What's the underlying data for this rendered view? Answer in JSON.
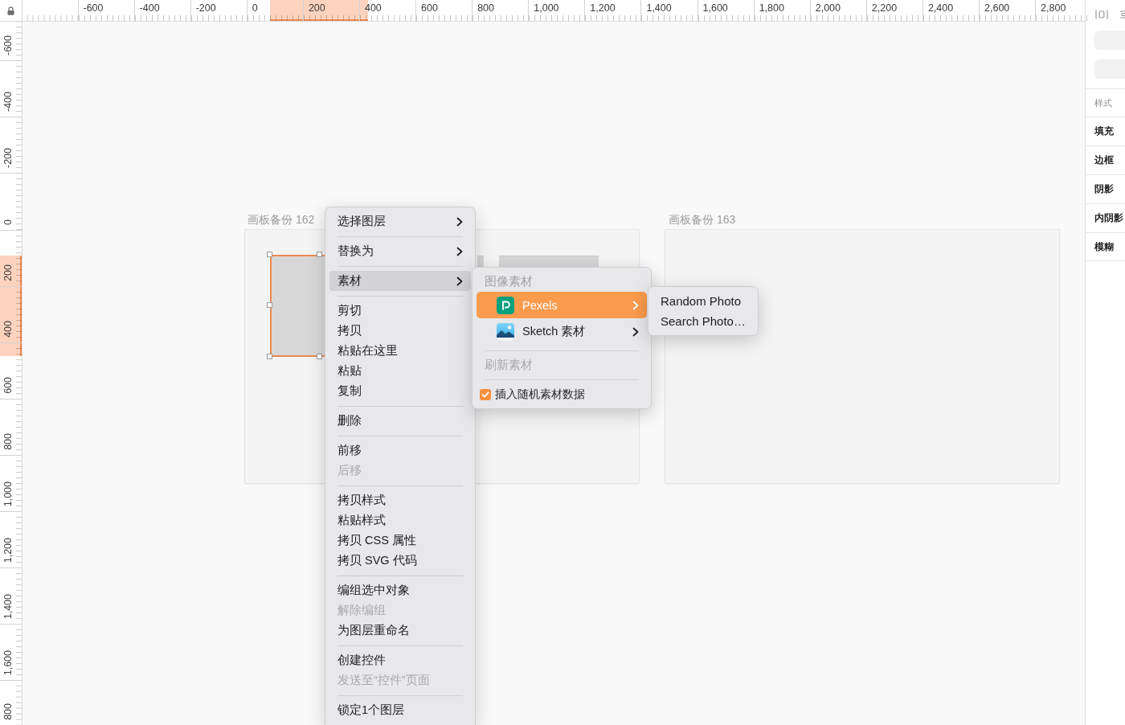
{
  "rulers": {
    "horizontal": [
      "-600",
      "-400",
      "-200",
      "0",
      "200",
      "400",
      "600",
      "800",
      "1,000",
      "1,200",
      "1,400",
      "1,600",
      "1,800",
      "2,000",
      "2,200",
      "2,400",
      "2,600",
      "2,800"
    ],
    "vertical": [
      "-600",
      "-400",
      "-200",
      "0",
      "200",
      "400",
      "600",
      "800",
      "1,000",
      "1,200",
      "1,400",
      "1,600",
      "800"
    ]
  },
  "canvas": {
    "artboards": [
      {
        "title": "画板备份 162"
      },
      {
        "title": "画板备份 163"
      }
    ]
  },
  "context_menu": {
    "items": [
      {
        "kind": "item",
        "label": "选择图层",
        "submenu": true,
        "disabled": false,
        "selected": false
      },
      {
        "kind": "separator"
      },
      {
        "kind": "item",
        "label": "替换为",
        "submenu": true,
        "disabled": false,
        "selected": false
      },
      {
        "kind": "separator"
      },
      {
        "kind": "item",
        "label": "素材",
        "submenu": true,
        "disabled": false,
        "selected": true
      },
      {
        "kind": "separator"
      },
      {
        "kind": "item",
        "label": "剪切",
        "submenu": false,
        "disabled": false,
        "selected": false
      },
      {
        "kind": "item",
        "label": "拷贝",
        "submenu": false,
        "disabled": false,
        "selected": false
      },
      {
        "kind": "item",
        "label": "粘贴在这里",
        "submenu": false,
        "disabled": false,
        "selected": false
      },
      {
        "kind": "item",
        "label": "粘贴",
        "submenu": false,
        "disabled": false,
        "selected": false
      },
      {
        "kind": "item",
        "label": "复制",
        "submenu": false,
        "disabled": false,
        "selected": false
      },
      {
        "kind": "separator"
      },
      {
        "kind": "item",
        "label": "删除",
        "submenu": false,
        "disabled": false,
        "selected": false
      },
      {
        "kind": "separator"
      },
      {
        "kind": "item",
        "label": "前移",
        "submenu": false,
        "disabled": false,
        "selected": false
      },
      {
        "kind": "item",
        "label": "后移",
        "submenu": false,
        "disabled": true,
        "selected": false
      },
      {
        "kind": "separator"
      },
      {
        "kind": "item",
        "label": "拷贝样式",
        "submenu": false,
        "disabled": false,
        "selected": false
      },
      {
        "kind": "item",
        "label": "粘贴样式",
        "submenu": false,
        "disabled": false,
        "selected": false
      },
      {
        "kind": "item",
        "label": "拷贝 CSS 属性",
        "submenu": false,
        "disabled": false,
        "selected": false
      },
      {
        "kind": "item",
        "label": "拷贝 SVG 代码",
        "submenu": false,
        "disabled": false,
        "selected": false
      },
      {
        "kind": "separator"
      },
      {
        "kind": "item",
        "label": "编组选中对象",
        "submenu": false,
        "disabled": false,
        "selected": false
      },
      {
        "kind": "item",
        "label": "解除编组",
        "submenu": false,
        "disabled": true,
        "selected": false
      },
      {
        "kind": "item",
        "label": "为图层重命名",
        "submenu": false,
        "disabled": false,
        "selected": false
      },
      {
        "kind": "separator"
      },
      {
        "kind": "item",
        "label": "创建控件",
        "submenu": false,
        "disabled": false,
        "selected": false
      },
      {
        "kind": "item",
        "label": "发送至“控件”页面",
        "submenu": false,
        "disabled": true,
        "selected": false
      },
      {
        "kind": "separator"
      },
      {
        "kind": "item",
        "label": "锁定1个图层",
        "submenu": false,
        "disabled": false,
        "selected": false
      }
    ]
  },
  "assets_submenu": {
    "header": "图像素材",
    "sources": [
      {
        "label": "Pexels",
        "selected": true,
        "submenu": true
      },
      {
        "label": "Sketch 素材",
        "selected": false,
        "submenu": true
      }
    ],
    "refresh": {
      "label": "刷新素材",
      "disabled": true
    },
    "random_data": {
      "label": "插入随机素材数据",
      "checked": true
    }
  },
  "photo_submenu": {
    "items": [
      "Random Photo",
      "Search Photo…"
    ]
  },
  "inspector": {
    "heading": "样式",
    "sections": [
      "填充",
      "边框",
      "阴影",
      "内阴影",
      "模糊"
    ]
  }
}
